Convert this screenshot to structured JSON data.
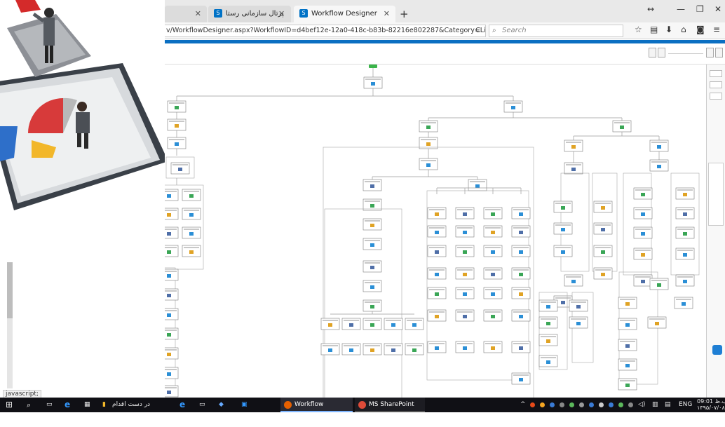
{
  "status_text": "javascript;",
  "browser": {
    "tabs": [
      {
        "label": ""
      },
      {
        "label": "پرتال سازمانی رستا"
      },
      {
        "label": "Workflow Designer"
      }
    ],
    "url": "v/WorkflowDesigner.aspx?WorkflowID=d4bef12e-12a0-418c-b83b-82216e802287&Category=List&ListId=",
    "search_placeholder": "Search",
    "accent": "#0b6fc2"
  },
  "taskbar": {
    "search_icon": "search-icon",
    "cortana_label": "در دست اقدام",
    "apps": [
      {
        "label": "Workflow Designer ..."
      },
      {
        "label": "MS SharePoint User..."
      }
    ],
    "lang": "ENG",
    "time": "09:01 ب.ظ",
    "date": "۱۳۹۵/۰۷/۰۸"
  }
}
